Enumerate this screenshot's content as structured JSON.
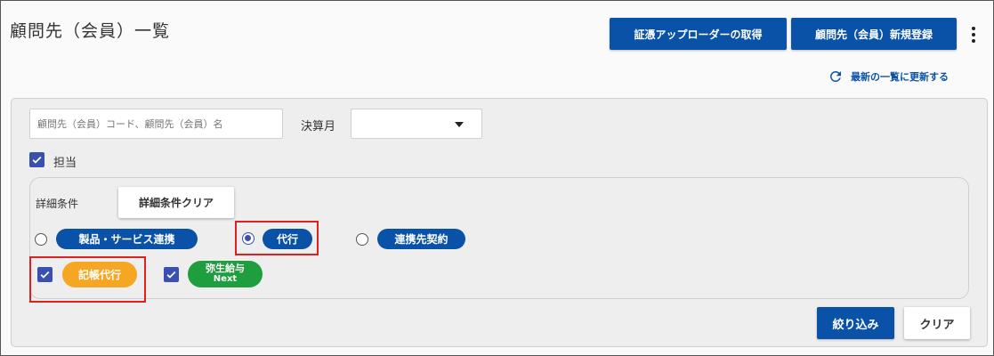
{
  "page": {
    "title": "顧問先（会員）一覧"
  },
  "header": {
    "cert_button_label": "証憑アップローダーの取得",
    "register_button_label": "顧問先（会員）新規登録",
    "refresh_label": "最新の一覧に更新する"
  },
  "filters": {
    "search_placeholder": "顧問先（会員）コード、顧問先（会員）名",
    "settlement_label": "決算月",
    "settlement_value": "",
    "assigned_label": "担当",
    "assigned_checked": true
  },
  "detail": {
    "label": "詳細条件",
    "clear_button_label": "詳細条件クリア",
    "radio_options": [
      {
        "label": "製品・サービス連携",
        "checked": false
      },
      {
        "label": "代行",
        "checked": true
      },
      {
        "label": "連携先契約",
        "checked": false
      }
    ],
    "checkbox_options": [
      {
        "label": "記帳代行",
        "checked": true
      },
      {
        "label": "弥生給与",
        "sublabel": "Next",
        "checked": true
      }
    ]
  },
  "actions": {
    "apply_label": "絞り込み",
    "clear_label": "クリア"
  },
  "colors": {
    "primary": "#0a52a8",
    "checkbox": "#3a4fb0",
    "orange_tag": "#f5a623",
    "green_tag": "#1e9e3e",
    "highlight": "#e02020"
  }
}
